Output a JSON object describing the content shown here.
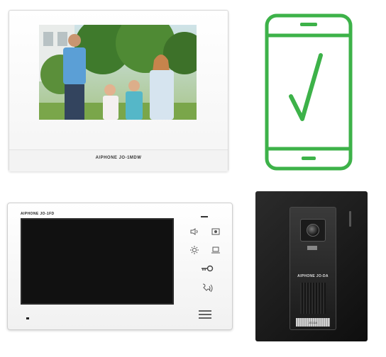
{
  "monitor_main": {
    "brand_label": "AIPHONE JO-1MDW"
  },
  "smartphone_app": {
    "icon": "phone-check-icon",
    "accent_color": "#3db249"
  },
  "monitor_secondary": {
    "brand_label": "AIPHONE JO-1FD",
    "buttons": [
      {
        "icon": "volume-icon",
        "glyph": "◁)"
      },
      {
        "icon": "camera-view-icon",
        "glyph": "▣"
      },
      {
        "icon": "brightness-icon",
        "glyph": "☼"
      },
      {
        "icon": "screen-icon",
        "glyph": "▭"
      },
      {
        "icon": "key-unlock-icon",
        "glyph": "⊸"
      },
      {
        "icon": "talk-icon",
        "glyph": "))"
      },
      {
        "icon": "menu-icon",
        "glyph": "≡"
      }
    ]
  },
  "door_station": {
    "brand_label": "AIPHONE JO-DA",
    "nameplate": "JO-DA"
  }
}
